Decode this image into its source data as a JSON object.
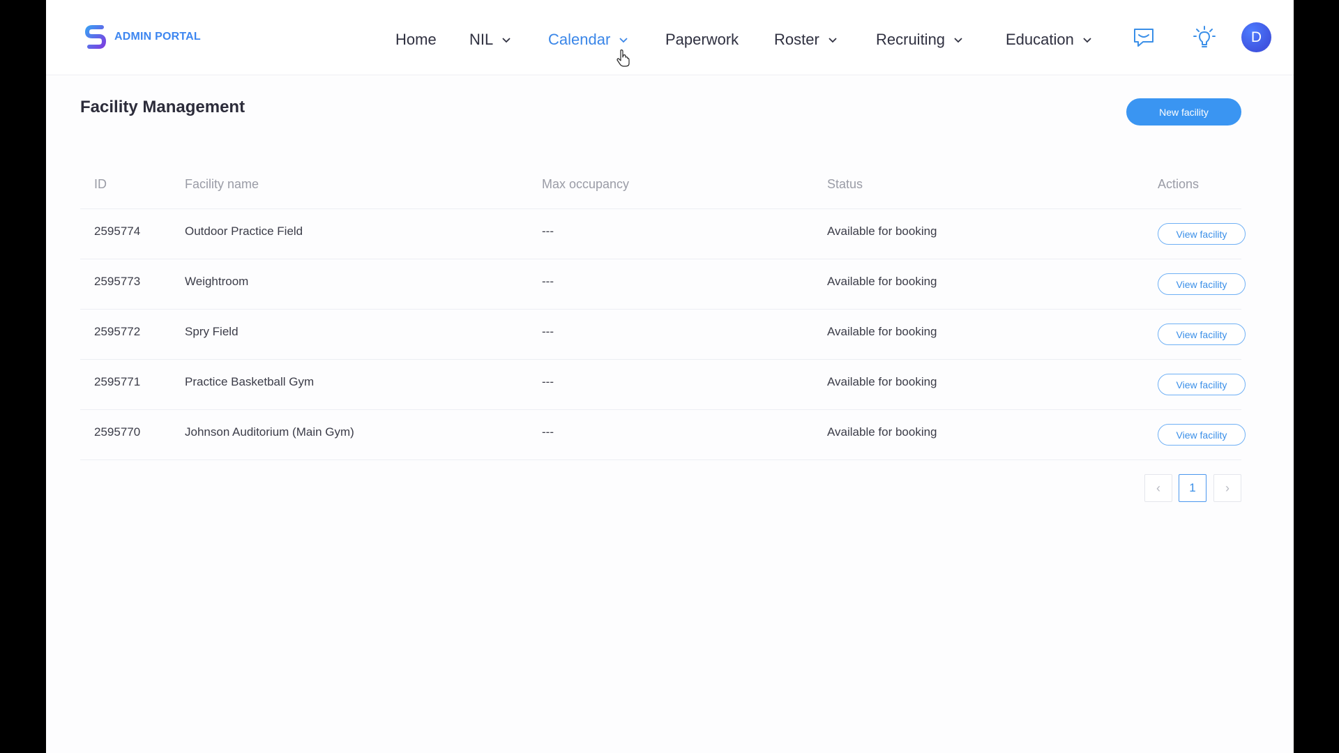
{
  "brand": {
    "name": "ADMIN PORTAL"
  },
  "nav": {
    "items": [
      {
        "label": "Home",
        "dropdown": false,
        "active": false
      },
      {
        "label": "NIL",
        "dropdown": true,
        "active": false
      },
      {
        "label": "Calendar",
        "dropdown": true,
        "active": true
      },
      {
        "label": "Paperwork",
        "dropdown": false,
        "active": false
      },
      {
        "label": "Roster",
        "dropdown": true,
        "active": false
      },
      {
        "label": "Recruiting",
        "dropdown": true,
        "active": false
      },
      {
        "label": "Education",
        "dropdown": true,
        "active": false
      }
    ],
    "icons": [
      "chat-icon",
      "lightbulb-icon"
    ],
    "avatar_initial": "D"
  },
  "page": {
    "title": "Facility Management",
    "new_button": "New facility"
  },
  "table": {
    "columns": [
      "ID",
      "Facility name",
      "Max occupancy",
      "Status",
      "Actions"
    ],
    "rows": [
      {
        "id": "2595774",
        "name": "Outdoor Practice Field",
        "max": "---",
        "status": "Available for booking",
        "action": "View facility"
      },
      {
        "id": "2595773",
        "name": "Weightroom",
        "max": "---",
        "status": "Available for booking",
        "action": "View facility"
      },
      {
        "id": "2595772",
        "name": "Spry Field",
        "max": "---",
        "status": "Available for booking",
        "action": "View facility"
      },
      {
        "id": "2595771",
        "name": "Practice Basketball Gym",
        "max": "---",
        "status": "Available for booking",
        "action": "View facility"
      },
      {
        "id": "2595770",
        "name": "Johnson Auditorium (Main Gym)",
        "max": "---",
        "status": "Available for booking",
        "action": "View facility"
      }
    ]
  },
  "pagination": {
    "prev": "‹",
    "current": "1",
    "next": "›"
  },
  "colors": {
    "accent": "#3a95f2",
    "active_nav": "#3a86e8",
    "avatar": "#3f54e0"
  }
}
